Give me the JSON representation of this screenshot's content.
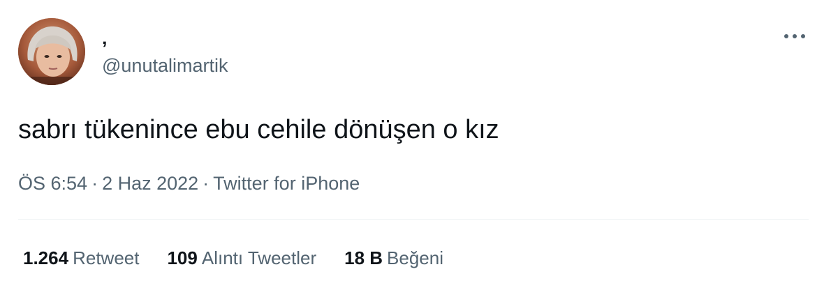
{
  "author": {
    "display_name": "‚",
    "handle": "@unutalimartik",
    "avatar_icon": "profile-photo"
  },
  "tweet": {
    "text": "sabrı tükenince ebu cehile dönüşen o kız"
  },
  "meta": {
    "time": "ÖS 6:54",
    "separator_1": "·",
    "date": "2 Haz 2022",
    "separator_2": "·",
    "source": "Twitter for iPhone"
  },
  "stats": {
    "retweets": {
      "count": "1.264",
      "label": "Retweet"
    },
    "quotes": {
      "count": "109",
      "label": "Alıntı Tweetler"
    },
    "likes": {
      "count": "18 B",
      "label": "Beğeni"
    }
  },
  "icons": {
    "more": "more-horizontal-icon"
  },
  "colors": {
    "primary_text": "#0f1419",
    "secondary_text": "#536471",
    "divider": "#eff3f4"
  }
}
